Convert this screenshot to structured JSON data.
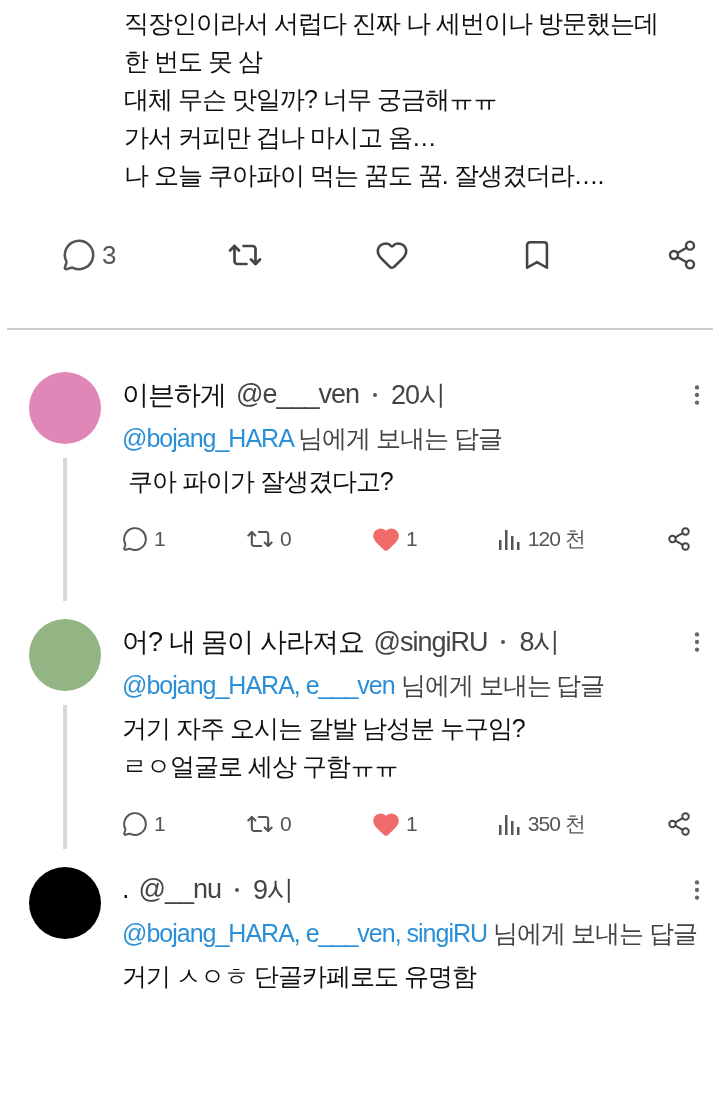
{
  "post": {
    "lines": [
      "직장인이라서 서럽다 진짜 나 세번이나 방문했는데",
      "한 번도 못 삼",
      "대체 무슨 맛일까? 너무 궁금해ㅠㅠ",
      "가서 커피만 겁나 마시고 옴…",
      "나 오늘 쿠아파이 먹는 꿈도 꿈. 잘생겼더라…."
    ],
    "actions": {
      "replies": "3",
      "liked": false
    }
  },
  "replies": [
    {
      "name": "이븐하게",
      "handle": "@e___ven",
      "time": "20시",
      "color": "#df88b8",
      "threaded": true,
      "reply_to": "@bojang_HARA",
      "reply_suffix": "님에게 보내는 답글",
      "lines": [
        " 쿠아 파이가 잘생겼다고?"
      ],
      "actions": {
        "replies": "1",
        "reposts": "0",
        "liked": true,
        "likes": "1",
        "views": "120 천"
      }
    },
    {
      "name": "어? 내 몸이 사라져요",
      "handle": "@singiRU",
      "time": "8시",
      "color": "#93b584",
      "threaded": true,
      "reply_to": "@bojang_HARA, e___ven",
      "reply_suffix": "님에게 보내는 답글",
      "lines": [
        "거기 자주 오시는 갈발 남성분 누구임?",
        "ㄹㅇ얼굴로 세상 구함ㅠㅠ"
      ],
      "actions": {
        "replies": "1",
        "reposts": "0",
        "liked": true,
        "likes": "1",
        "views": "350 천"
      }
    },
    {
      "name": ".",
      "handle": "@__nu",
      "time": "9시",
      "color": "#000000",
      "threaded": false,
      "reply_to": "@bojang_HARA, e___ven, singiRU",
      "reply_suffix": "님에게 보내는 답글",
      "lines": [
        "거기 ㅅㅇㅎ 단골카페로도 유명함"
      ]
    }
  ]
}
